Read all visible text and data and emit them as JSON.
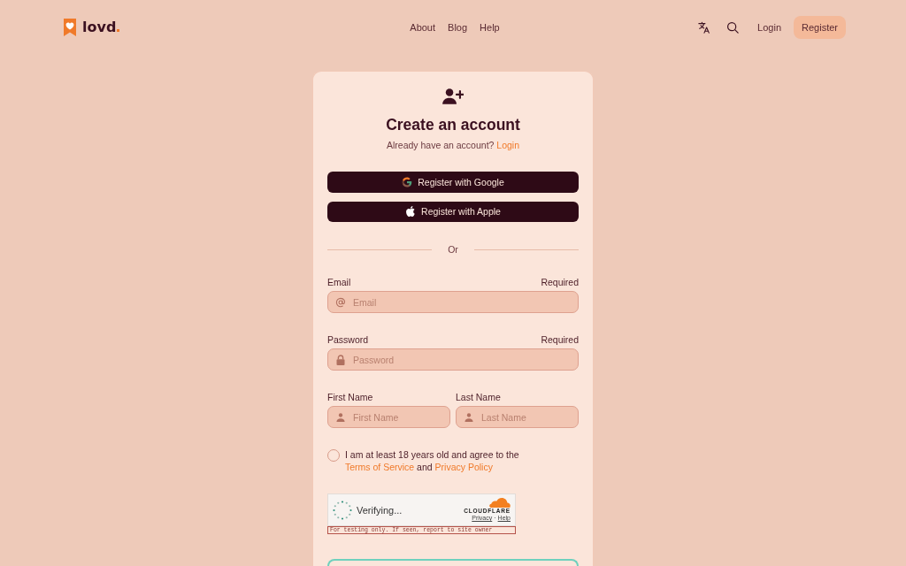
{
  "header": {
    "logo": "lovd",
    "nav": [
      {
        "label": "About"
      },
      {
        "label": "Blog"
      },
      {
        "label": "Help"
      }
    ],
    "actions": [
      {
        "kind": "link",
        "label": "Login"
      },
      {
        "kind": "button",
        "label": "Register"
      }
    ]
  },
  "card": {
    "title": "Create an account",
    "subtitle": {
      "text": "Already have an account?",
      "link": "Login"
    },
    "social_buttons": [
      {
        "kind": "google",
        "label": "Register with Google"
      },
      {
        "kind": "apple",
        "label": "Register with Apple"
      }
    ],
    "divider": "Or",
    "fields": [
      {
        "kind": "email",
        "label": "Email",
        "hint": "Required",
        "placeholder": "Email"
      },
      {
        "kind": "password",
        "label": "Password",
        "hint": "Required",
        "placeholder": "Password"
      }
    ],
    "name_fields": [
      {
        "kind": "person",
        "label": "First Name",
        "placeholder": "First Name"
      },
      {
        "kind": "person",
        "label": "Last Name",
        "placeholder": "Last Name"
      }
    ],
    "consent": {
      "checked": false,
      "parts": [
        {
          "kind": "text",
          "text": "I am at least 18 years old and agree to the "
        },
        {
          "kind": "link",
          "text": "Terms of Service"
        },
        {
          "kind": "text",
          "text": " and "
        },
        {
          "kind": "link",
          "text": "Privacy Policy"
        }
      ]
    },
    "captcha": {
      "status": "Verifying...",
      "brand": "CLOUDFLARE",
      "links": [
        "Privacy",
        "Help"
      ],
      "separator": "·",
      "notice": "For testing only. If seen, report to site owner"
    }
  }
}
